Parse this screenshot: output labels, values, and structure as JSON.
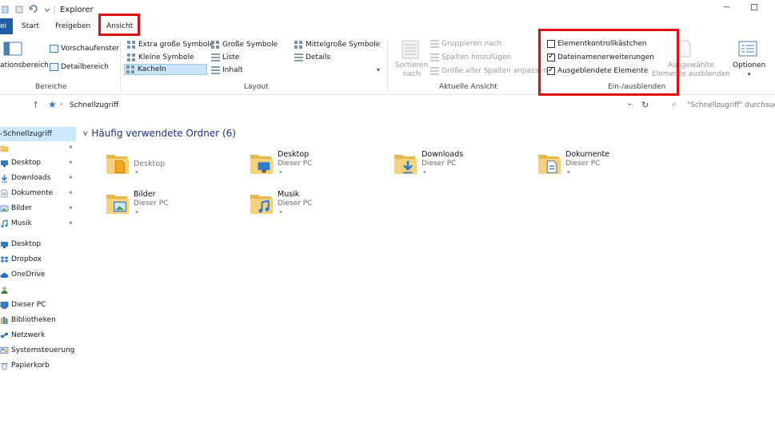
{
  "window": {
    "title": "Explorer",
    "minimize_glyph": "—",
    "maximize_glyph": "☐"
  },
  "tabs": {
    "file": "ei",
    "start": "Start",
    "share": "Freigeben",
    "view": "Ansicht"
  },
  "ribbon": {
    "bereiche": {
      "navpane_label": "ationsbereich",
      "preview": "Vorschaufenster",
      "details": "Detailbereich",
      "group_label": "Bereiche"
    },
    "layout": {
      "items": {
        "extra_large": "Extra große Symbole",
        "large": "Große Symbole",
        "medium": "Mittelgroße Symbole",
        "small": "Kleine Symbole",
        "list": "Liste",
        "details": "Details",
        "tiles": "Kacheln",
        "content": "Inhalt"
      },
      "group_label": "Layout"
    },
    "current_view": {
      "sort_line1": "Sortieren",
      "sort_line2": "nach",
      "group_by": "Gruppieren nach",
      "add_columns": "Spalten hinzufügen",
      "size_all": "Größe aller Spalten anpassen",
      "group_label": "Aktuelle Ansicht"
    },
    "show_hide": {
      "item_checkboxes": "Elementkontrollkästchen",
      "file_extensions": "Dateinamenerweiterungen",
      "hidden_items": "Ausgeblendete Elemente",
      "hide_selected_line1": "Ausgewählte",
      "hide_selected_line2": "Elemente ausblenden",
      "group_label": "Ein-/ausblenden",
      "checked": {
        "item_checkboxes": false,
        "file_extensions": true,
        "hidden_items": true
      }
    },
    "options": {
      "label": "Optionen",
      "arrow": "▾"
    }
  },
  "address": {
    "location": "Schnellzugriff",
    "search_placeholder": "\"Schnellzugriff\" durchsuchen",
    "refresh": "↻",
    "dropdown": "⌄"
  },
  "nav": {
    "quick_access": "Schnellzugriff",
    "items": [
      {
        "label": "",
        "icon": "folder-icon",
        "pinned": true
      },
      {
        "label": "Desktop",
        "icon": "desktop-icon",
        "pinned": true
      },
      {
        "label": "Downloads",
        "icon": "download-icon",
        "pinned": true
      },
      {
        "label": "Dokumente",
        "icon": "document-icon",
        "pinned": true
      },
      {
        "label": "Bilder",
        "icon": "picture-icon",
        "pinned": true
      },
      {
        "label": "Musik",
        "icon": "music-icon",
        "pinned": true
      }
    ],
    "roots": [
      {
        "label": "Desktop",
        "icon": "desktop-icon"
      },
      {
        "label": "Dropbox",
        "icon": "dropbox-icon"
      },
      {
        "label": "OneDrive",
        "icon": "cloud-icon"
      },
      {
        "label": "",
        "icon": "user-icon"
      },
      {
        "label": "Dieser PC",
        "icon": "pc-icon"
      },
      {
        "label": "Bibliotheken",
        "icon": "library-icon"
      },
      {
        "label": "Netzwerk",
        "icon": "network-icon"
      },
      {
        "label": "Systemsteuerung",
        "icon": "control-panel-icon"
      },
      {
        "label": "Papierkorb",
        "icon": "recycle-bin-icon"
      }
    ],
    "pin_glyph": "✦"
  },
  "content": {
    "section_title": "Häufig verwendete Ordner (6)",
    "chevron": "∨",
    "folders": [
      {
        "name": "",
        "location": "Desktop",
        "icon": "folder-icon",
        "overlay": "file-icon"
      },
      {
        "name": "Desktop",
        "location": "Dieser PC",
        "icon": "folder-icon",
        "overlay": "desktop-icon"
      },
      {
        "name": "Downloads",
        "location": "Dieser PC",
        "icon": "folder-icon",
        "overlay": "download-icon"
      },
      {
        "name": "Dokumente",
        "location": "Dieser PC",
        "icon": "folder-icon",
        "overlay": "document-icon"
      },
      {
        "name": "Bilder",
        "location": "Dieser PC",
        "icon": "folder-icon",
        "overlay": "picture-icon"
      },
      {
        "name": "Musik",
        "location": "Dieser PC",
        "icon": "folder-icon",
        "overlay": "music-icon"
      }
    ]
  },
  "colors": {
    "accent": "#1f5fa8",
    "highlight": "#e01010",
    "selection": "#cce8ff",
    "folder": "#f3c85a"
  }
}
